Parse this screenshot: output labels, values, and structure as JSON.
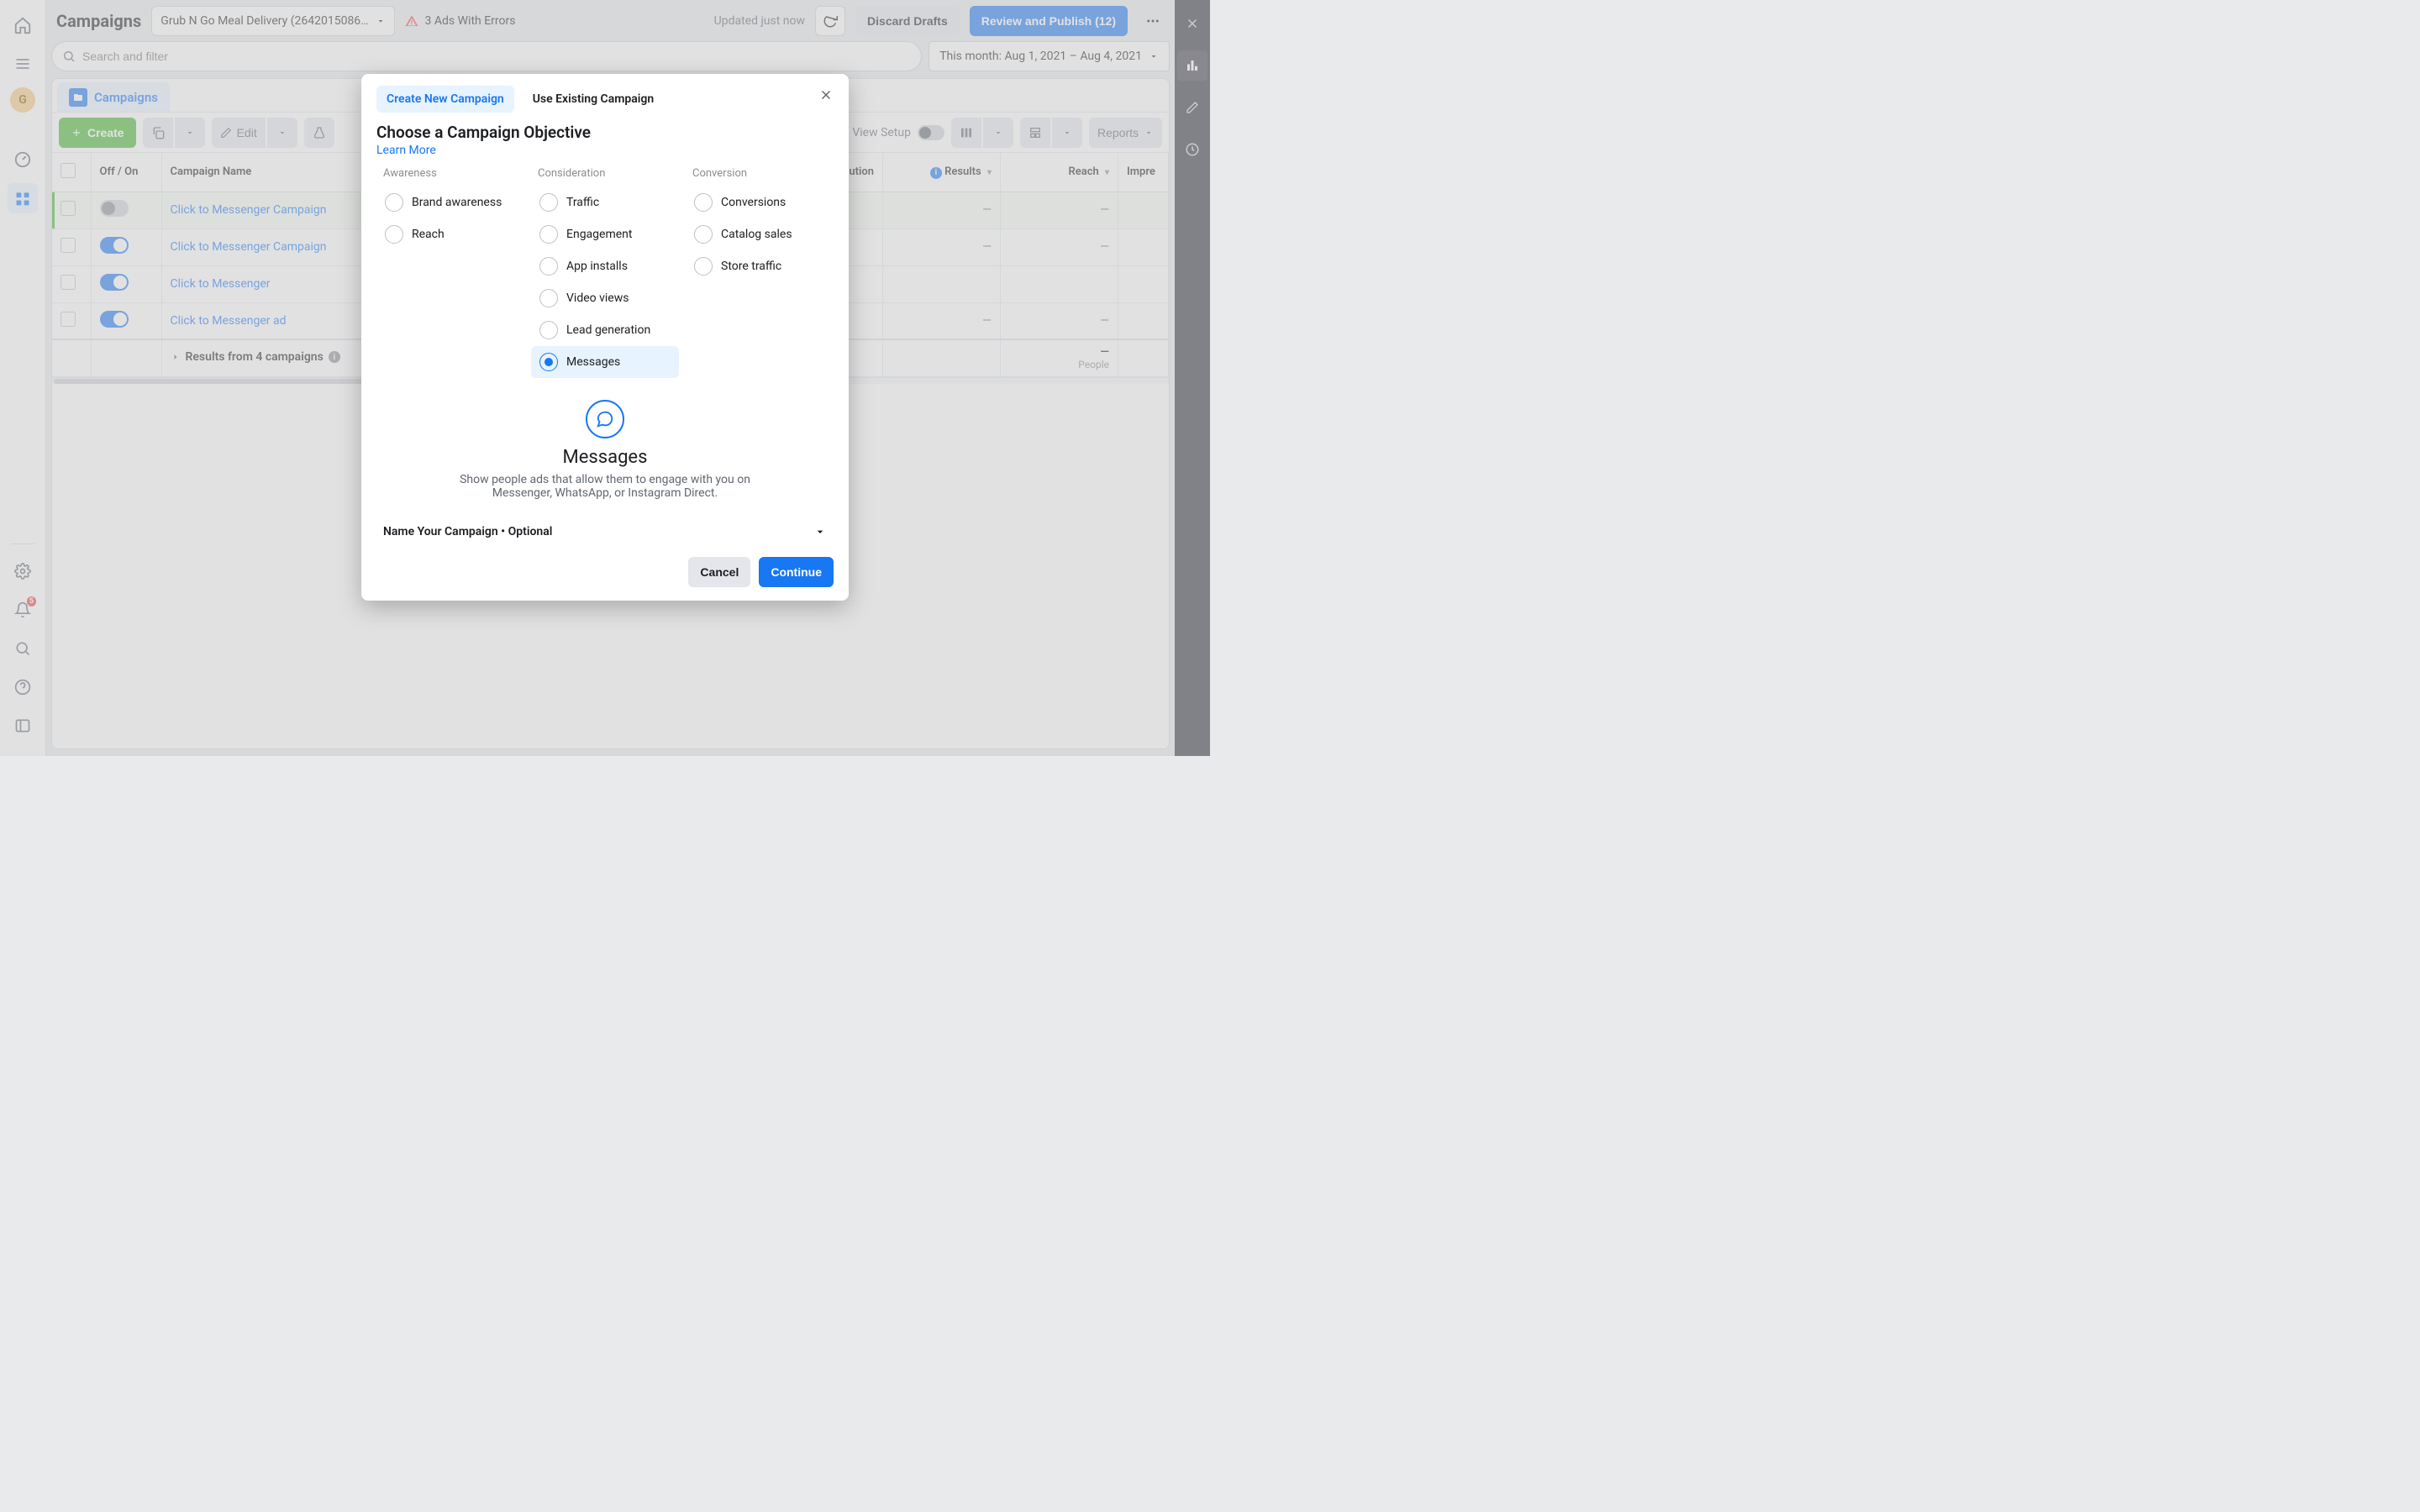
{
  "header": {
    "page_title": "Campaigns",
    "account_name": "Grub N Go Meal Delivery (2642015086…",
    "error_banner": "3 Ads With Errors",
    "updated": "Updated just now",
    "discard": "Discard Drafts",
    "review": "Review and Publish (12)"
  },
  "search": {
    "placeholder": "Search and filter",
    "date_range": "This month: Aug 1, 2021 – Aug 4, 2021"
  },
  "tabs": {
    "active": "Campaigns"
  },
  "toolbar": {
    "create": "Create",
    "edit": "Edit",
    "view_setup": "View Setup",
    "reports": "Reports"
  },
  "columns": {
    "checkbox": "",
    "offon": "Off / On",
    "name": "Campaign Name",
    "attribution": "Attribution",
    "results": "Results",
    "reach": "Reach",
    "impressions": "Impre"
  },
  "rows": [
    {
      "on": false,
      "name": "Click to Messenger Campaign",
      "results": "—",
      "reach": "—"
    },
    {
      "on": true,
      "name": "Click to Messenger Campaign",
      "results": "—",
      "reach": "—"
    },
    {
      "on": true,
      "name": "Click to Messenger",
      "results": "",
      "reach": ""
    },
    {
      "on": true,
      "name": "Click to Messenger ad",
      "results": "—",
      "reach": "—"
    }
  ],
  "footer": {
    "label": "Results from 4 campaigns",
    "reach_value": "—",
    "reach_sub": "People"
  },
  "avatar_letter": "G",
  "notif_count": "5",
  "modal": {
    "tab_new": "Create New Campaign",
    "tab_existing": "Use Existing Campaign",
    "title": "Choose a Campaign Objective",
    "learn": "Learn More",
    "groups": {
      "awareness": {
        "title": "Awareness",
        "options": [
          "Brand awareness",
          "Reach"
        ]
      },
      "consideration": {
        "title": "Consideration",
        "options": [
          "Traffic",
          "Engagement",
          "App installs",
          "Video views",
          "Lead generation",
          "Messages"
        ]
      },
      "conversion": {
        "title": "Conversion",
        "options": [
          "Conversions",
          "Catalog sales",
          "Store traffic"
        ]
      }
    },
    "selected": "Messages",
    "preview_title": "Messages",
    "preview_desc": "Show people ads that allow them to engage with you on Messenger, WhatsApp, or Instagram Direct.",
    "name_row": "Name Your Campaign • Optional",
    "cancel": "Cancel",
    "continue": "Continue"
  }
}
